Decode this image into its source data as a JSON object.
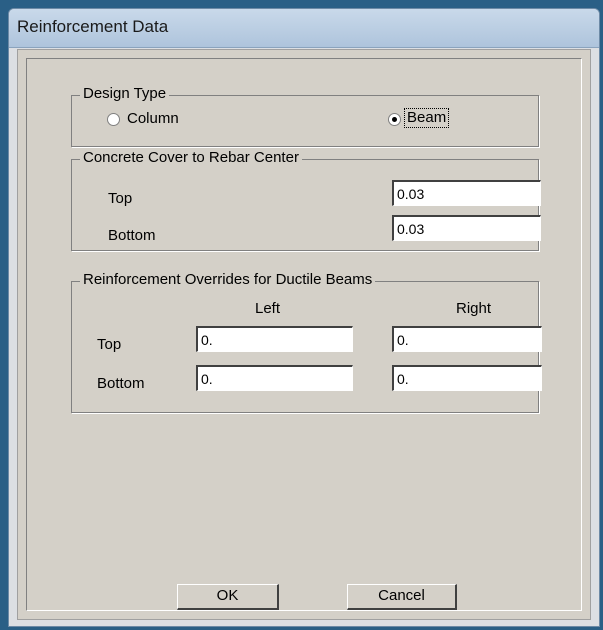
{
  "window": {
    "title": "Reinforcement Data"
  },
  "design_type": {
    "legend": "Design Type",
    "options": [
      {
        "label": "Column",
        "selected": false
      },
      {
        "label": "Beam",
        "selected": true
      }
    ]
  },
  "concrete_cover": {
    "legend": "Concrete Cover to Rebar Center",
    "top_label": "Top",
    "top_value": "0.03",
    "bottom_label": "Bottom",
    "bottom_value": "0.03"
  },
  "overrides": {
    "legend": "Reinforcement Overrides for Ductile Beams",
    "left_header": "Left",
    "right_header": "Right",
    "top_label": "Top",
    "bottom_label": "Bottom",
    "top_left": "0.",
    "top_right": "0.",
    "bottom_left": "0.",
    "bottom_right": "0."
  },
  "buttons": {
    "ok": "OK",
    "cancel": "Cancel"
  }
}
